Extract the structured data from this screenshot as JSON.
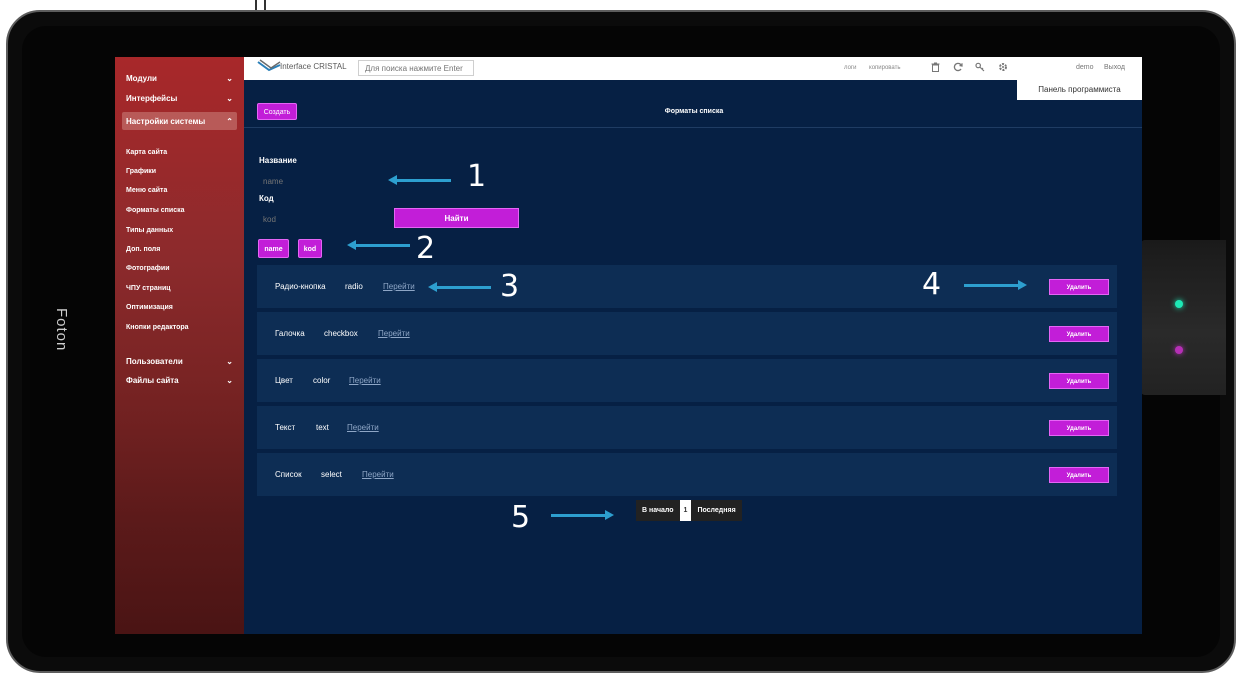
{
  "device": {
    "label": "Foton"
  },
  "sidebar": {
    "sections": [
      {
        "label": "Модули",
        "chevron": "⌄"
      },
      {
        "label": "Интерфейсы",
        "chevron": "⌄"
      },
      {
        "label": "Настройки системы",
        "chevron": "⌃"
      }
    ],
    "subitems": [
      "Карта сайта",
      "Графики",
      "Меню сайта",
      "Форматы списка",
      "Типы данных",
      "Доп. поля",
      "Фотографии",
      "ЧПУ страниц",
      "Оптимизация",
      "Кнопки редактора"
    ],
    "bottom_sections": [
      {
        "label": "Пользователи",
        "chevron": "⌄"
      },
      {
        "label": "Файлы сайта",
        "chevron": "⌄"
      }
    ]
  },
  "topbar": {
    "logo_text": "Interface CRISTAL",
    "search_placeholder": "Для поиска нажмите Enter",
    "link_logs": "логи",
    "link_copy": "копировать",
    "user": "demo",
    "logout": "Выход",
    "programmer_panel": "Панель программиста",
    "icons": [
      "trash-icon",
      "refresh-icon",
      "key-icon",
      "gear-icon"
    ]
  },
  "main": {
    "create_label": "Создать",
    "title": "Форматы списка",
    "name_label": "Название",
    "name_placeholder": "name",
    "code_label": "Код",
    "code_placeholder": "kod",
    "find_label": "Найти",
    "tags": [
      "name",
      "kod"
    ],
    "rows": [
      {
        "name": "Радио-кнопка",
        "code": "radio",
        "link": "Перейти",
        "delete": "Удалить"
      },
      {
        "name": "Галочка",
        "code": "checkbox",
        "link": "Перейти",
        "delete": "Удалить"
      },
      {
        "name": "Цвет",
        "code": "color",
        "link": "Перейти",
        "delete": "Удалить"
      },
      {
        "name": "Текст",
        "code": "text",
        "link": "Перейти",
        "delete": "Удалить"
      },
      {
        "name": "Список",
        "code": "select",
        "link": "Перейти",
        "delete": "Удалить"
      }
    ],
    "pager": {
      "first": "В начало",
      "current": "1",
      "last": "Последняя"
    }
  },
  "annotations": [
    "1",
    "2",
    "3",
    "4",
    "5"
  ],
  "colors": {
    "accent": "#c21ed8",
    "sidebar": "#a8282a",
    "background": "#062044",
    "arrow": "#2d9fcf"
  }
}
